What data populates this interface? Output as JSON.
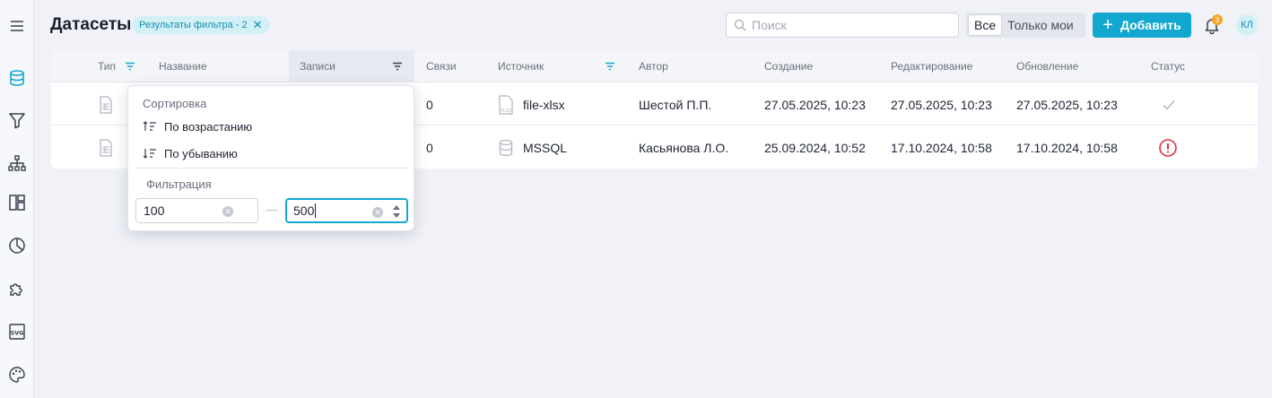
{
  "header": {
    "title": "Датасеты",
    "filter_chip": "Результаты фильтра - 2",
    "search_placeholder": "Поиск",
    "segment": [
      "Все",
      "Только мои"
    ],
    "add_label": "Добавить",
    "notifications_count": "3",
    "user_initials": "КЛ"
  },
  "rail_icons": [
    "menu-icon",
    "database-icon",
    "filter-icon",
    "hierarchy-icon",
    "dashboard-layout-icon",
    "pie-chart-icon",
    "puzzle-icon",
    "svg-icon",
    "palette-icon"
  ],
  "table": {
    "columns": [
      "Тип",
      "Название",
      "Записи",
      "Связи",
      "Источник",
      "Автор",
      "Создание",
      "Редактирование",
      "Обновление",
      "Статус"
    ],
    "rows": [
      {
        "links": "0",
        "source": "file-xlsx",
        "author": "Шестой П.П.",
        "created": "27.05.2025, 10:23",
        "edited": "27.05.2025, 10:23",
        "updated": "27.05.2025, 10:23",
        "status": "ok"
      },
      {
        "links": "0",
        "source": "MSSQL",
        "author": "Касьянова Л.О.",
        "created": "25.09.2024, 10:52",
        "edited": "17.10.2024, 10:58",
        "updated": "17.10.2024, 10:58",
        "status": "error"
      }
    ]
  },
  "popover": {
    "sort_title": "Сортировка",
    "sort_asc": "По возрастанию",
    "sort_desc": "По убыванию",
    "filter_title": "Фильтрация",
    "min_value": "100",
    "max_value": "500"
  },
  "colors": {
    "accent": "#12a7cf",
    "error": "#e0304a",
    "badge": "#f5a623"
  }
}
